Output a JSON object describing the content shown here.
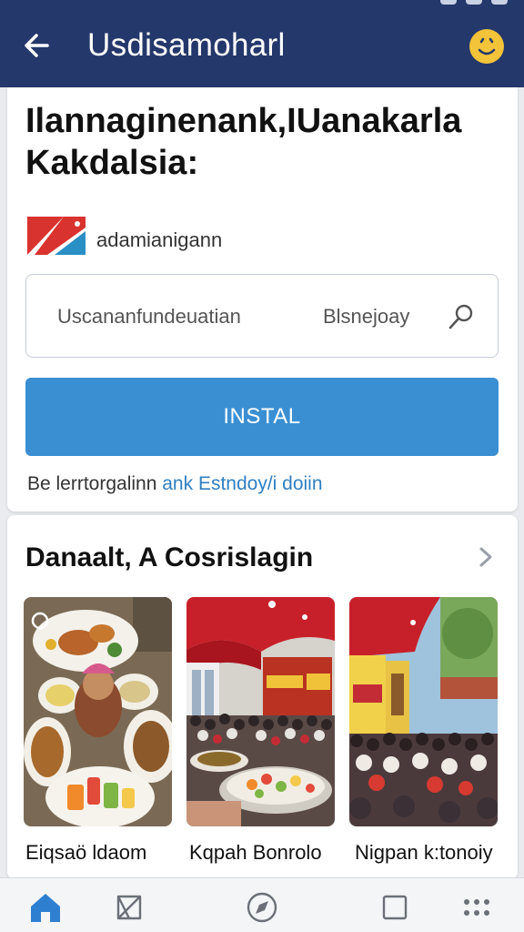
{
  "app_bar": {
    "title": "Usdisamoharl",
    "back_icon": "arrow-left-icon",
    "profile_icon": "profile-icon",
    "accent": "#24386b",
    "badge_color": "#f3c33a"
  },
  "main_card": {
    "headline": "Ilannaginenank,IUanakarla Kakdalsia:",
    "brand": {
      "name": "adamianigann",
      "logo_icon": "brand-flag-logo"
    },
    "search": {
      "placeholder": "Uscananfundeuatian",
      "date_label": "Blsnejoay",
      "mic_icon": "microphone-icon"
    },
    "install_button": {
      "label": "INSTAL",
      "color": "#3a8fd3"
    },
    "footnote": {
      "text": "Be lerrtorgalinn",
      "link": "ank Estndoy/i doiin"
    }
  },
  "feed": {
    "title": "Danaalt, A Cosrislagin",
    "more_icon": "chevron-right-icon",
    "items": [
      {
        "label": "Eiqsaö ldaom",
        "image": "food-platter-photo"
      },
      {
        "label": "Kqpah Bonrolo",
        "image": "event-hall-photo"
      },
      {
        "label": "Nigpan k:tonoiy",
        "image": "crowd-gathering-photo"
      }
    ]
  },
  "bottom_nav": {
    "items": [
      {
        "name": "home",
        "icon": "home-icon",
        "active": true
      },
      {
        "name": "send",
        "icon": "send-icon",
        "active": false
      },
      {
        "name": "explore",
        "icon": "compass-icon",
        "active": false
      },
      {
        "name": "tabs",
        "icon": "square-icon",
        "active": false
      },
      {
        "name": "menu",
        "icon": "grid-dots-icon",
        "active": false
      }
    ],
    "active_color": "#2f7fd0"
  }
}
